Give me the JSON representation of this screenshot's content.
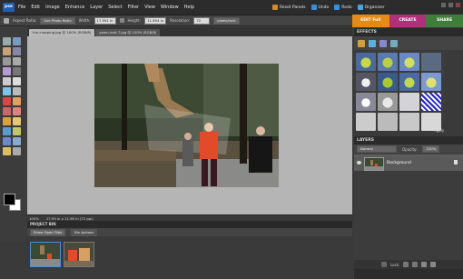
{
  "app": {
    "logo": "pse"
  },
  "menu": [
    "File",
    "Edit",
    "Image",
    "Enhance",
    "Layer",
    "Select",
    "Filter",
    "View",
    "Window",
    "Help"
  ],
  "top_right": {
    "reset_panels": "Reset Panels",
    "undo": "Undo",
    "redo": "Redo",
    "organizer": "Organizer"
  },
  "options_bar": {
    "aspect_ratio_label": "Aspect Ratio:",
    "aspect_ratio_value": "Use Photo Ratio",
    "width_label": "Width:",
    "width_value": "17.991 in",
    "height_label": "Height:",
    "height_value": "11.994 in",
    "resolution_label": "Resolution:",
    "resolution_value": "72",
    "resolution_unit": "pixels/inch"
  },
  "mode_tabs": [
    {
      "label": "EDIT Full",
      "color": "#e58a16"
    },
    {
      "label": "CREATE",
      "color": "#b0307a"
    },
    {
      "label": "SHARE",
      "color": "#3f7d3a"
    }
  ],
  "doc_tabs": [
    {
      "label": "fun-cropping.jpg @ 100% (RGB/8)",
      "active": true
    },
    {
      "label": "gwen-text-7.jpg @ 100% (RGB/8)",
      "active": false
    }
  ],
  "status": {
    "zoom": "100%",
    "doc_info": "17.99 in x 11.99 in (72 ppi)"
  },
  "project_bin": {
    "title": "PROJECT BIN",
    "show_dropdown": "Show Open Files",
    "bin_actions": "Bin Actions"
  },
  "effects": {
    "title": "EFFECTS",
    "apply": "Apply"
  },
  "layers": {
    "title": "LAYERS",
    "blend_mode": "Normal",
    "opacity_label": "Opacity:",
    "opacity_value": "100%",
    "lock_label": "Lock:",
    "layer_name": "Background"
  }
}
